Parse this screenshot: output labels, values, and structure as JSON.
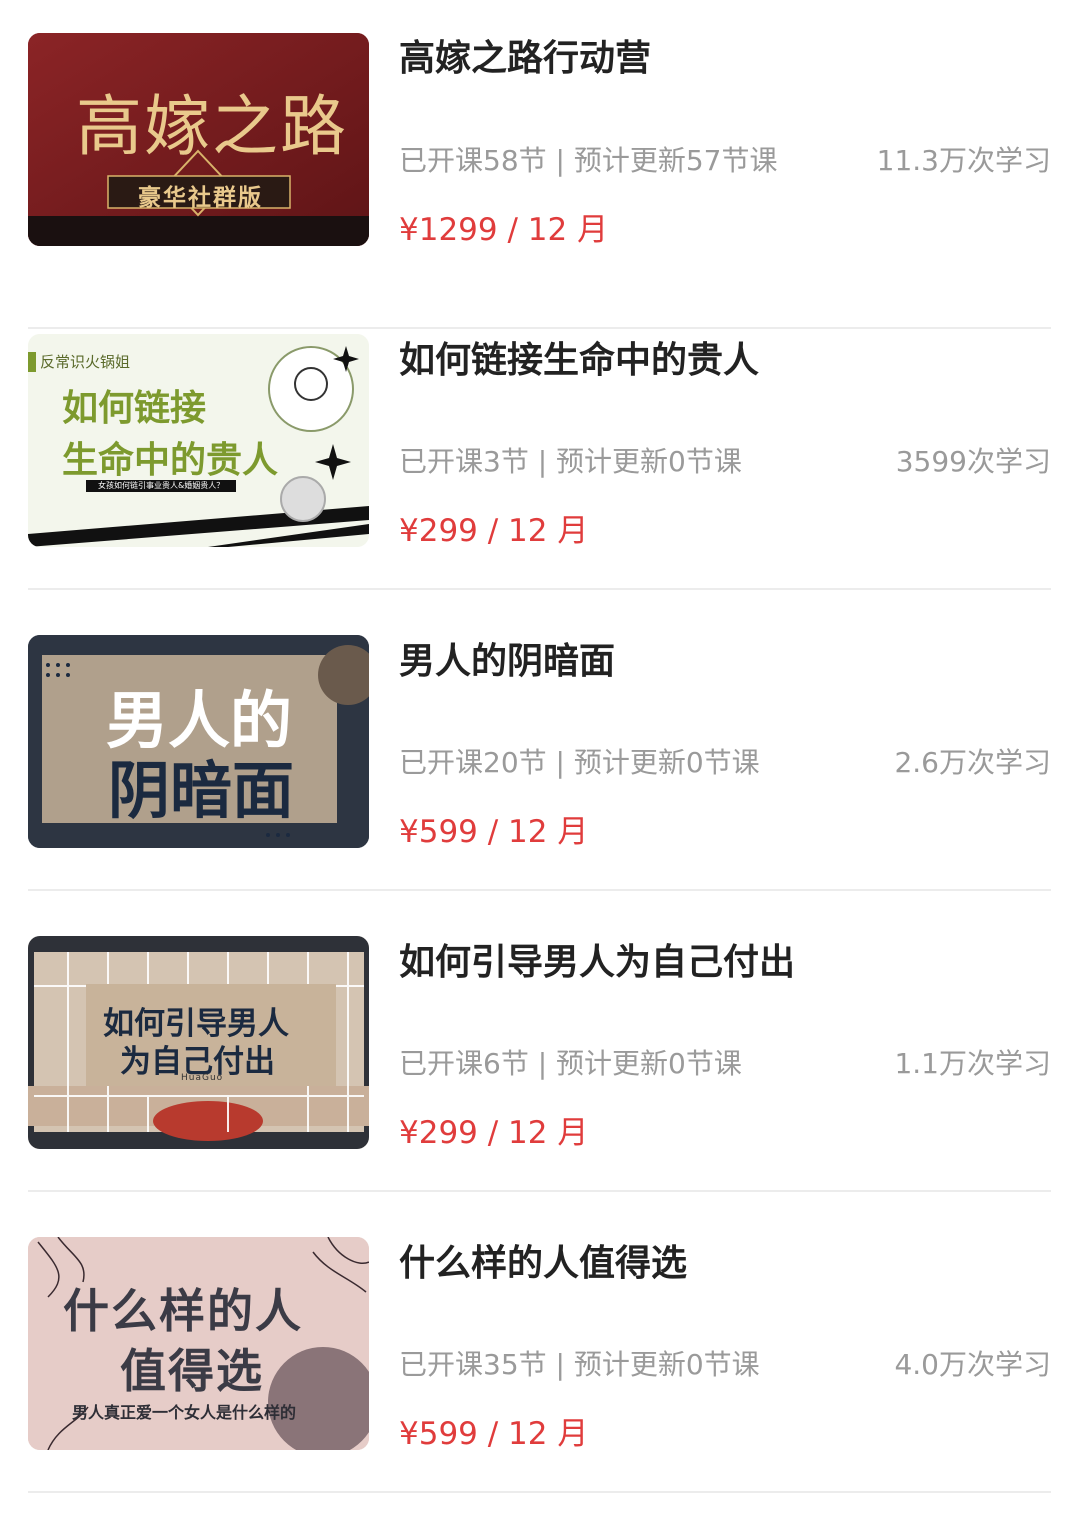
{
  "courses": [
    {
      "title": "高嫁之路行动营",
      "meta": "已开课58节 | 预计更新57节课",
      "count": "11.3万次学习",
      "price": "¥1299 / 12 月",
      "thumb": {
        "line1": "高嫁之路",
        "badge": "豪华社群版",
        "bg": "#7a1d1f"
      }
    },
    {
      "title": "如何链接生命中的贵人",
      "meta": "已开课3节 | 预计更新0节课",
      "count": "3599次学习",
      "price": "¥299 / 12 月",
      "thumb": {
        "tag": "反常识火锅姐",
        "line1": "如何链接",
        "line2": "生命中的贵人",
        "small": "女孩如何链引事业贵人&婚姻贵人？",
        "bg": "#f3f6ec"
      }
    },
    {
      "title": "男人的阴暗面",
      "meta": "已开课20节 | 预计更新0节课",
      "count": "2.6万次学习",
      "price": "¥599 / 12 月",
      "thumb": {
        "line1": "男人的",
        "line2": "阴暗面",
        "bg": "#2d3542"
      }
    },
    {
      "title": "如何引导男人为自己付出",
      "meta": "已开课6节 | 预计更新0节课",
      "count": "1.1万次学习",
      "price": "¥299 / 12 月",
      "thumb": {
        "line1": "如何引导男人",
        "line2": "为自己付出",
        "small": "HuaGuo",
        "bg": "#d9c9b6"
      }
    },
    {
      "title": "什么样的人值得选",
      "meta": "已开课35节 | 预计更新0节课",
      "count": "4.0万次学习",
      "price": "¥599 / 12 月",
      "thumb": {
        "line1": "什么样的人",
        "line2": "值得选",
        "small": "男人真正爱一个女人是什么样的",
        "bg": "#e4c9c5"
      }
    }
  ]
}
